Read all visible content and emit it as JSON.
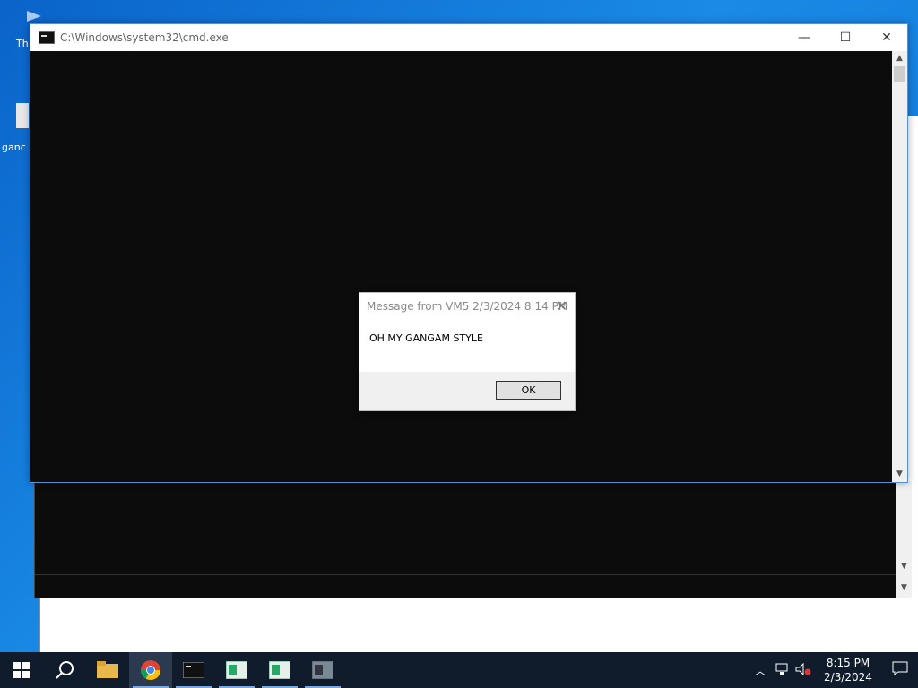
{
  "desktop": {
    "icon_labels": [
      "Th",
      "ganc"
    ]
  },
  "cmd_window": {
    "title": "C:\\Windows\\system32\\cmd.exe",
    "minimize_glyph": "—",
    "maximize_glyph": "☐",
    "close_glyph": "✕"
  },
  "dialog": {
    "title": "Message from VM5 2/3/2024 8:14 PM",
    "message": "OH MY GANGAM STYLE",
    "ok_label": "OK",
    "close_glyph": "✕"
  },
  "taskbar": {
    "items": [
      "start-icon",
      "search-icon",
      "file-explorer-icon",
      "chrome-icon",
      "cmd-icon",
      "app-window-icon",
      "app-window-icon",
      "app-window-icon"
    ],
    "time": "8:15 PM",
    "date": "2/3/2024"
  },
  "colors": {
    "taskbar": "#101c2c",
    "console": "#0c0c0c",
    "accent": "#0a63c9"
  }
}
